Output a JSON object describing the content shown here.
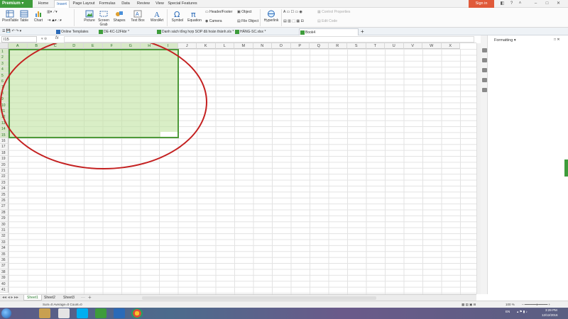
{
  "menubar": {
    "premium": "Premium",
    "tabs": [
      "Home",
      "Insert",
      "Page Layout",
      "Formulas",
      "Data",
      "Review",
      "View",
      "Special Features"
    ],
    "active_tab": "Insert",
    "signin": "Sign in"
  },
  "ribbon": {
    "pivottable": "PivotTable",
    "table": "Table",
    "chart": "Chart",
    "picture": "Picture",
    "screen_grab": "Screen Grab",
    "shapes": "Shapes",
    "text_box": "Text Box",
    "wordart": "WordArt",
    "symbol": "Symbol",
    "equation": "Equation",
    "header_footer": "Header/Footer",
    "object": "Object",
    "camera": "Camera",
    "file_object": "File Object",
    "hyperlink": "Hyperlink",
    "control_properties": "Control Properties",
    "edit_code": "Edit Code"
  },
  "doctabs": {
    "online_templates": "Online Templates",
    "tabs": [
      "DE-KC-12Fkbr *",
      "Danh sách tổng hợp SOP đã hoàn thành.xls *",
      "HÀNG-SC.xlsx *",
      "Book4"
    ],
    "active_index": 3,
    "add": "+"
  },
  "formula_bar": {
    "namebox": "I15",
    "fx": "fx"
  },
  "grid": {
    "columns": [
      "A",
      "B",
      "C",
      "D",
      "E",
      "F",
      "G",
      "H",
      "I",
      "J",
      "K",
      "L",
      "M",
      "N",
      "O",
      "P",
      "Q",
      "R",
      "S",
      "T",
      "U",
      "V",
      "W",
      "X"
    ],
    "rows": [
      "1",
      "2",
      "3",
      "4",
      "5",
      "6",
      "7",
      "8",
      "9",
      "10",
      "11",
      "12",
      "13",
      "14",
      "15",
      "16",
      "17",
      "18",
      "19",
      "20",
      "21",
      "22",
      "23",
      "24",
      "25",
      "26",
      "27",
      "28",
      "29",
      "30",
      "31",
      "32",
      "33",
      "34",
      "35",
      "36",
      "37",
      "38",
      "39",
      "40",
      "41"
    ],
    "selected_columns": [
      "A",
      "B",
      "C",
      "D",
      "E",
      "F",
      "G",
      "H",
      "I"
    ],
    "selected_rows": [
      "1",
      "2",
      "3",
      "4",
      "5",
      "6",
      "7",
      "8",
      "9",
      "10",
      "11",
      "12",
      "13",
      "14",
      "15"
    ]
  },
  "right_pane": {
    "title": "Formatting"
  },
  "sheets": {
    "tabs": [
      "Sheet1",
      "Sheet2",
      "Sheet3"
    ],
    "active": "Sheet1",
    "add": "+"
  },
  "statusbar": {
    "stats": "Sum=0   Average=0   Count=0",
    "zoom": "100 %"
  },
  "taskbar": {
    "lang": "EN",
    "time": "3:29 PM",
    "date": "12/12/2016"
  },
  "colors": {
    "accent_green": "#3e9c3b",
    "selection_fill": "#bfe2a0",
    "annotation_red": "#c42020",
    "signin": "#e05a3a"
  }
}
